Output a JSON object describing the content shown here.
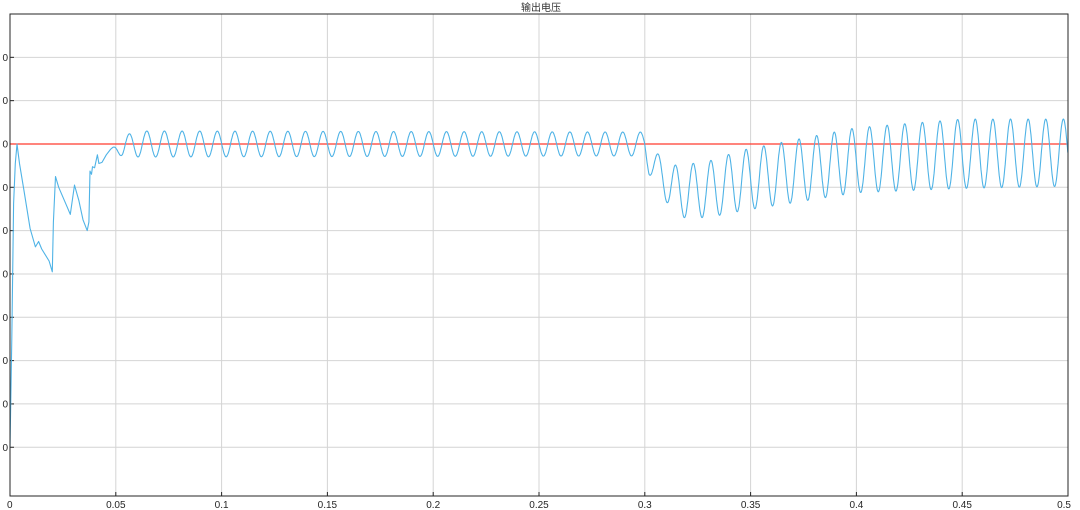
{
  "title": "输出电压",
  "colors": {
    "background": "#ffffff",
    "grid": "#d4d4d4",
    "axis_border": "#262626",
    "signal": "#4fb3e6",
    "reference": "#ff3b2f"
  },
  "chart_data": {
    "type": "line",
    "title": "输出电压",
    "xlabel": "",
    "ylabel": "",
    "xlim": [
      0,
      0.5
    ],
    "ylim": [
      -25,
      420
    ],
    "x_ticks": [
      0,
      0.05,
      0.1,
      0.15,
      0.2,
      0.25,
      0.3,
      0.35,
      0.4,
      0.45,
      0.5
    ],
    "x_tick_labels": [
      "0",
      "0.05",
      "0.1",
      "0.15",
      "0.2",
      "0.25",
      "0.3",
      "0.35",
      "0.4",
      "0.45",
      "0.5"
    ],
    "y_ticks": [
      20,
      60,
      100,
      140,
      180,
      220,
      260,
      300,
      340,
      380
    ],
    "y_tick_labels": [
      "0",
      "0",
      "0",
      "0",
      "0",
      "0",
      "0",
      "0",
      "0",
      "0"
    ],
    "grid": true,
    "legend": "none",
    "series": [
      {
        "reference_line": true,
        "x": [
          0,
          0.5
        ],
        "y": [
          300,
          300
        ]
      },
      {
        "envelope": [
          {
            "t": 0.0475,
            "center": 295,
            "amp": 8
          },
          {
            "t": 0.06,
            "center": 300,
            "amp": 12
          },
          {
            "t": 0.3,
            "center": 300,
            "amp": 11
          },
          {
            "t": 0.302,
            "center": 284,
            "amp": 12
          },
          {
            "t": 0.315,
            "center": 256,
            "amp": 24
          },
          {
            "t": 0.33,
            "center": 258,
            "amp": 26
          },
          {
            "t": 0.345,
            "center": 266,
            "amp": 28
          },
          {
            "t": 0.4,
            "center": 285,
            "amp": 30
          },
          {
            "t": 0.45,
            "center": 291,
            "amp": 32
          },
          {
            "t": 0.5,
            "center": 292,
            "amp": 31
          }
        ],
        "period": 0.00833,
        "startup": {
          "x": [
            0,
            0.00085,
            0.0017,
            0.0025,
            0.0033,
            0.0045,
            0.0065,
            0.0095,
            0.012,
            0.0135,
            0.015,
            0.0185,
            0.02,
            0.0205,
            0.0215,
            0.023,
            0.027,
            0.0285,
            0.0305,
            0.0325,
            0.0345,
            0.0365,
            0.0373,
            0.0378,
            0.0385,
            0.039,
            0.04,
            0.0413,
            0.042,
            0.0435,
            0.0455,
            0.0475
          ],
          "y": [
            20,
            120,
            245,
            282,
            300,
            282,
            258,
            222,
            205,
            210,
            203,
            192,
            182,
            228,
            270,
            260,
            242,
            235,
            262,
            248,
            230,
            220,
            228,
            275,
            272,
            279,
            278,
            290,
            282,
            283,
            290,
            295
          ]
        }
      }
    ]
  }
}
